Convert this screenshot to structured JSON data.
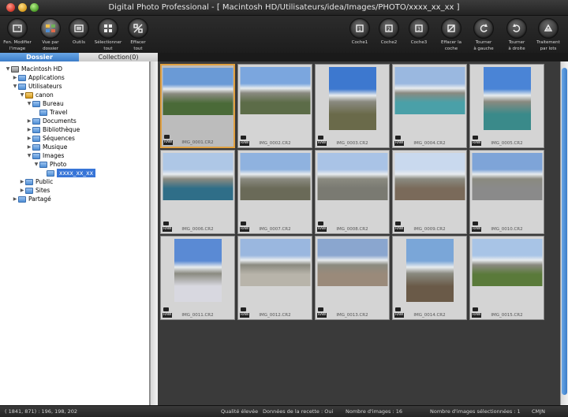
{
  "window": {
    "title": "Digital Photo Professional - [ Macintosh HD/Utilisateurs/idea/Images/PHOTO/xxxx_xx_xx ]"
  },
  "toolbar_left": [
    {
      "label_1": "Fen. Modifier",
      "label_2": "l'image",
      "icon": "edit-image-icon"
    },
    {
      "label_1": "Vue par",
      "label_2": "dossier",
      "icon": "folder-view-icon"
    },
    {
      "label_1": "Outils",
      "label_2": "",
      "icon": "tools-icon"
    },
    {
      "label_1": "Sélectionner",
      "label_2": "tout",
      "icon": "select-all-icon"
    },
    {
      "label_1": "Effacer",
      "label_2": "tout",
      "icon": "clear-all-icon"
    }
  ],
  "toolbar_right": [
    {
      "label_1": "Coche1",
      "label_2": "",
      "icon": "check1-icon"
    },
    {
      "label_1": "Coche2",
      "label_2": "",
      "icon": "check2-icon"
    },
    {
      "label_1": "Coche3",
      "label_2": "",
      "icon": "check3-icon"
    },
    {
      "label_1": "Effacer la",
      "label_2": "coche",
      "icon": "clear-check-icon"
    },
    {
      "label_1": "Tourner",
      "label_2": "à gauche",
      "icon": "rotate-left-icon"
    },
    {
      "label_1": "Tourner",
      "label_2": "à droite",
      "icon": "rotate-right-icon"
    },
    {
      "label_1": "Traitement",
      "label_2": "par lots",
      "icon": "batch-process-icon"
    }
  ],
  "tabs": {
    "folder": "Dossier",
    "collection": "Collection(0)"
  },
  "tree": [
    {
      "label": "Macintosh HD",
      "level": 0,
      "expanded": true,
      "icon": "drive"
    },
    {
      "label": "Applications",
      "level": 1,
      "expanded": false,
      "icon": "folder"
    },
    {
      "label": "Utilisateurs",
      "level": 1,
      "expanded": true,
      "icon": "folder"
    },
    {
      "label": "canon",
      "level": 2,
      "expanded": true,
      "icon": "home"
    },
    {
      "label": "Bureau",
      "level": 3,
      "expanded": true,
      "icon": "folder"
    },
    {
      "label": "Travel",
      "level": 4,
      "expanded": null,
      "icon": "folder"
    },
    {
      "label": "Documents",
      "level": 3,
      "expanded": false,
      "icon": "folder"
    },
    {
      "label": "Bibliothèque",
      "level": 3,
      "expanded": false,
      "icon": "folder"
    },
    {
      "label": "Séquences",
      "level": 3,
      "expanded": false,
      "icon": "folder"
    },
    {
      "label": "Musique",
      "level": 3,
      "expanded": false,
      "icon": "folder"
    },
    {
      "label": "Images",
      "level": 3,
      "expanded": true,
      "icon": "folder"
    },
    {
      "label": "Photo",
      "level": 4,
      "expanded": true,
      "icon": "folder"
    },
    {
      "label": "xxxx_xx_xx",
      "level": 5,
      "expanded": null,
      "icon": "folder",
      "selected": true
    },
    {
      "label": "Public",
      "level": 2,
      "expanded": false,
      "icon": "folder"
    },
    {
      "label": "Sites",
      "level": 2,
      "expanded": false,
      "icon": "folder"
    },
    {
      "label": "Partagé",
      "level": 1,
      "expanded": false,
      "icon": "folder"
    }
  ],
  "thumbnails": [
    {
      "name": "IMG_0001.CR2",
      "orient": "landscape",
      "selected": true,
      "sky": "#6a9ad6",
      "ground": "#4a6a38"
    },
    {
      "name": "IMG_0002.CR2",
      "orient": "landscape",
      "selected": false,
      "sky": "#7ba6de",
      "ground": "#5c6c48"
    },
    {
      "name": "IMG_0003.CR2",
      "orient": "portrait",
      "selected": false,
      "sky": "#3d78cf",
      "ground": "#6a6a4a"
    },
    {
      "name": "IMG_0004.CR2",
      "orient": "landscape",
      "selected": false,
      "sky": "#9ab8e0",
      "ground": "#4aa0a8"
    },
    {
      "name": "IMG_0005.CR2",
      "orient": "portrait",
      "selected": false,
      "sky": "#4a84d6",
      "ground": "#3a8a8a"
    },
    {
      "name": "IMG_0006.CR2",
      "orient": "landscape",
      "selected": false,
      "sky": "#aec7e6",
      "ground": "#2f6e88"
    },
    {
      "name": "IMG_0007.CR2",
      "orient": "landscape",
      "selected": false,
      "sky": "#8fb2df",
      "ground": "#6a6a58"
    },
    {
      "name": "IMG_0008.CR2",
      "orient": "landscape",
      "selected": false,
      "sky": "#a9c3e6",
      "ground": "#7a7a72"
    },
    {
      "name": "IMG_0009.CR2",
      "orient": "landscape",
      "selected": false,
      "sky": "#c9d9ee",
      "ground": "#7a6a5a"
    },
    {
      "name": "IMG_0010.CR2",
      "orient": "landscape",
      "selected": false,
      "sky": "#7ea4d8",
      "ground": "#8a8a8a"
    },
    {
      "name": "IMG_0011.CR2",
      "orient": "portrait",
      "selected": false,
      "sky": "#5a8ad4",
      "ground": "#d8d8e0"
    },
    {
      "name": "IMG_0012.CR2",
      "orient": "landscape",
      "selected": false,
      "sky": "#9ab7df",
      "ground": "#b8b4aa"
    },
    {
      "name": "IMG_0013.CR2",
      "orient": "landscape",
      "selected": false,
      "sky": "#8aa6cf",
      "ground": "#9a8a7a"
    },
    {
      "name": "IMG_0014.CR2",
      "orient": "portrait",
      "selected": false,
      "sky": "#7aa6d8",
      "ground": "#6a5a48"
    },
    {
      "name": "IMG_0015.CR2",
      "orient": "landscape",
      "selected": false,
      "sky": "#a8c4e6",
      "ground": "#5a7a3a"
    }
  ],
  "status": {
    "coords": "( 1841, 871) : 196, 198, 202",
    "quality": "Qualité élevée",
    "recipe": "Données de la recette : Oui",
    "count": "Nombre d'images : 16",
    "selected": "Nombre d'images sélectionnées : 1",
    "colorspace": "CMJN"
  }
}
